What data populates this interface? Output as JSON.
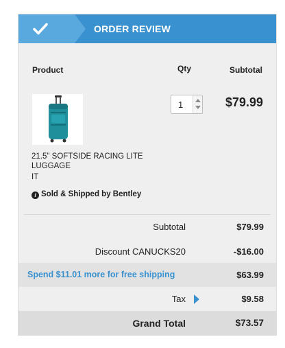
{
  "header": {
    "title": "ORDER REVIEW",
    "icon": "checkmark-icon"
  },
  "columns": {
    "product": "Product",
    "qty": "Qty",
    "subtotal": "Subtotal"
  },
  "item": {
    "name": "21.5\" SOFTSIDE RACING LITE LUGGAGE",
    "sku": "IT",
    "qty": "1",
    "price": "$79.99",
    "sold_by": "Sold & Shipped by Bentley",
    "image_color": "#1f8f9c"
  },
  "summary": {
    "subtotal_label": "Subtotal",
    "subtotal_value": "$79.99",
    "discount_label": "Discount CANUCKS20",
    "discount_value": "-$16.00",
    "shipping_promo": "Spend $11.01 more for free shipping",
    "shipping_value": "$63.99",
    "tax_label": "Tax",
    "tax_value": "$9.58",
    "total_label": "Grand Total",
    "total_value": "$73.57"
  },
  "colors": {
    "accent": "#3a91cf",
    "accent_light": "#5aa9de"
  }
}
